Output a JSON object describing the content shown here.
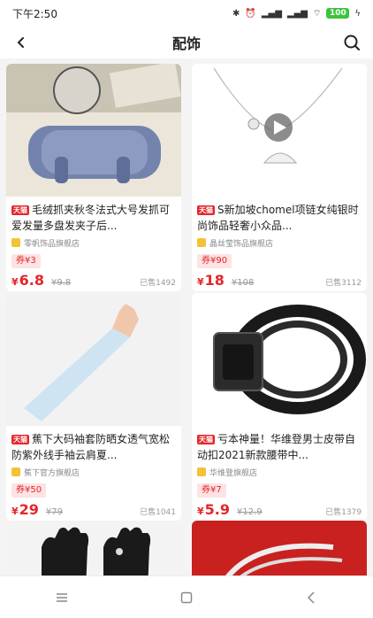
{
  "status": {
    "time": "下午2:50",
    "icons": [
      "bluetooth-icon",
      "alarm-icon",
      "signal-icon",
      "signal-icon",
      "wifi-icon",
      "battery-icon",
      "charging-icon"
    ],
    "battery": "100"
  },
  "header": {
    "title": "配饰",
    "back_icon": "back-arrow-icon",
    "search_icon": "search-icon"
  },
  "products": [
    {
      "tag": "天猫",
      "title": "毛绒抓夹秋冬法式大号发抓可爱发量多盘发夹子后...",
      "shop": "零帆饰品旗舰店",
      "coupon": "券¥3",
      "price": "6.8",
      "orig_price": "¥9.8",
      "sold": "已售1492"
    },
    {
      "tag": "天猫",
      "title": "S新加坡chomel项链女纯银时尚饰品轻奢小众品...",
      "shop": "晶丝莹饰品旗舰店",
      "coupon": "券¥90",
      "price": "18",
      "orig_price": "¥108",
      "sold": "已售3112"
    },
    {
      "tag": "天猫",
      "title": "蕉下大码袖套防晒女透气宽松防紫外线手袖云肩夏...",
      "shop": "蕉下官方旗舰店",
      "coupon": "券¥50",
      "price": "29",
      "orig_price": "¥79",
      "sold": "已售1041"
    },
    {
      "tag": "天猫",
      "title": "亏本神量！华维登男士皮带自动扣2021新款腰带中...",
      "shop": "华维登旗舰店",
      "coupon": "券¥7",
      "price": "5.9",
      "orig_price": "¥12.9",
      "sold": "已售1379"
    }
  ],
  "currency": "¥",
  "bottom_nav": {
    "menu_icon": "menu-icon",
    "home_icon": "home-square-icon",
    "back_icon": "back-triangle-icon"
  }
}
